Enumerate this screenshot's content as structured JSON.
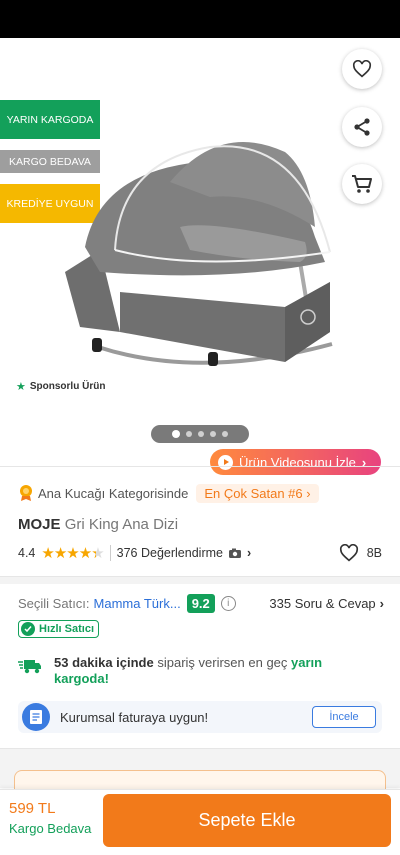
{
  "badges": {
    "tomorrow_cargo": "YARIN KARGODA",
    "free_cargo": "KARGO BEDAVA",
    "credit": "KREDİYE UYGUN"
  },
  "gallery": {
    "sponsored": "Sponsorlu Ürün",
    "image_count": 5,
    "active_index": 0,
    "video_button": "Ürün Videosunu İzle"
  },
  "category": {
    "text": "Ana Kucağı Kategorisinde",
    "rank_chip": "En Çok Satan #6"
  },
  "product": {
    "brand": "MOJE",
    "name": "Gri King Ana Dizi",
    "rating": "4.4",
    "rating_value": 4.4,
    "review_count": "376 Değerlendirme",
    "favorites": "8B"
  },
  "seller": {
    "label": "Seçili Satıcı:",
    "name": "Mamma Türk...",
    "score": "9.2",
    "qa": "335 Soru & Cevap",
    "fast_seller": "Hızlı Satıcı"
  },
  "delivery": {
    "bold_part": "53 dakika içinde",
    "normal_part": " sipariş verirsen en geç ",
    "green_part": "yarın kargoda!"
  },
  "invoice": {
    "text": "Kurumsal faturaya uygun!",
    "button": "İncele"
  },
  "bottom": {
    "price": "599 TL",
    "shipping": "Kargo Bedava",
    "add_to_cart": "Sepete Ekle"
  },
  "colors": {
    "brand_orange": "#f27a1a",
    "green": "#13a05a",
    "link_blue": "#2b6fd8",
    "star": "#f7a600"
  }
}
